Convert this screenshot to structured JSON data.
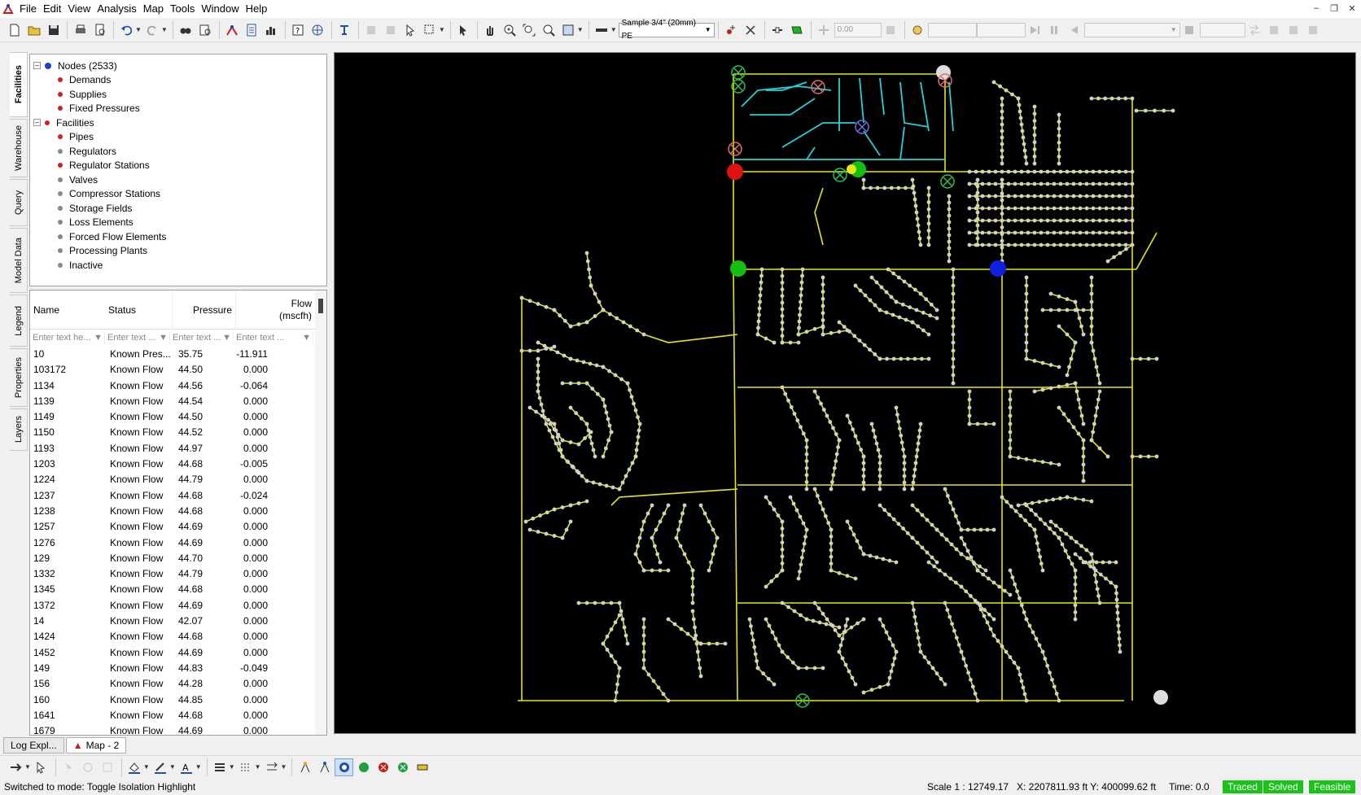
{
  "menubar": {
    "items": [
      "File",
      "Edit",
      "View",
      "Analysis",
      "Map",
      "Tools",
      "Window",
      "Help"
    ]
  },
  "toolbar": {
    "pipe_size_combo": "Sample 3/4\" (20mm) PE",
    "value_field": "0.00",
    "icons": [
      "new-icon",
      "open-icon",
      "save-icon",
      "print-icon",
      "print-preview-icon",
      "undo-icon",
      "redo-icon",
      "find-icon",
      "query-icon",
      "trace-icon",
      "report-icon",
      "chart-icon",
      "help-icon",
      "globe-icon",
      "layer-icon",
      "select-icon",
      "pan-icon",
      "zoom-in-icon",
      "zoom-extent-icon",
      "zoom-previous-icon",
      "zoom-window-icon",
      "pipe-tool-icon",
      "node-add-icon",
      "node-delete-icon",
      "regulator-icon",
      "supply-icon"
    ]
  },
  "sidetabs": [
    "Facilities",
    "Warehouse",
    "Query",
    "Model Data",
    "Legend",
    "Properties",
    "Layers"
  ],
  "tree": {
    "nodes_label": "Nodes (2533)",
    "node_children": [
      "Demands",
      "Supplies",
      "Fixed Pressures"
    ],
    "facilities_label": "Facilities",
    "facility_children": [
      "Pipes",
      "Regulators",
      "Regulator Stations",
      "Valves",
      "Compressor Stations",
      "Storage Fields",
      "Loss Elements",
      "Forced Flow Elements",
      "Processing Plants",
      "Inactive"
    ]
  },
  "grid": {
    "columns": [
      "Name",
      "Status",
      "Pressure",
      "Flow\n(mscfh)"
    ],
    "filter_placeholders": [
      "Enter text he...",
      "Enter text ...",
      "Enter text ...",
      "Enter text ..."
    ],
    "rows": [
      [
        "10",
        "Known Pres...",
        "35.75",
        "-11.911"
      ],
      [
        "103172",
        "Known Flow",
        "44.50",
        "0.000"
      ],
      [
        "1134",
        "Known Flow",
        "44.56",
        "-0.064"
      ],
      [
        "1139",
        "Known Flow",
        "44.54",
        "0.000"
      ],
      [
        "1149",
        "Known Flow",
        "44.50",
        "0.000"
      ],
      [
        "1150",
        "Known Flow",
        "44.52",
        "0.000"
      ],
      [
        "1193",
        "Known Flow",
        "44.97",
        "0.000"
      ],
      [
        "1203",
        "Known Flow",
        "44.68",
        "-0.005"
      ],
      [
        "1224",
        "Known Flow",
        "44.79",
        "0.000"
      ],
      [
        "1237",
        "Known Flow",
        "44.68",
        "-0.024"
      ],
      [
        "1238",
        "Known Flow",
        "44.68",
        "0.000"
      ],
      [
        "1257",
        "Known Flow",
        "44.69",
        "0.000"
      ],
      [
        "1276",
        "Known Flow",
        "44.69",
        "0.000"
      ],
      [
        "129",
        "Known Flow",
        "44.70",
        "0.000"
      ],
      [
        "1332",
        "Known Flow",
        "44.79",
        "0.000"
      ],
      [
        "1345",
        "Known Flow",
        "44.68",
        "0.000"
      ],
      [
        "1372",
        "Known Flow",
        "44.69",
        "0.000"
      ],
      [
        "14",
        "Known Flow",
        "42.07",
        "0.000"
      ],
      [
        "1424",
        "Known Flow",
        "44.68",
        "0.000"
      ],
      [
        "1452",
        "Known Flow",
        "44.69",
        "0.000"
      ],
      [
        "149",
        "Known Flow",
        "44.83",
        "-0.049"
      ],
      [
        "156",
        "Known Flow",
        "44.28",
        "0.000"
      ],
      [
        "160",
        "Known Flow",
        "44.85",
        "0.000"
      ],
      [
        "1641",
        "Known Flow",
        "44.68",
        "0.000"
      ],
      [
        "1679",
        "Known Flow",
        "44.69",
        "0.000"
      ]
    ]
  },
  "doc_tabs": [
    "Log Expl...",
    "Map - 2"
  ],
  "status": {
    "message": "Switched to mode: Toggle Isolation Highlight",
    "scale": "Scale  1 : 12749.17",
    "coords": "X: 2207811.93 ft Y: 400099.62 ft",
    "time": "Time: 0.0",
    "badges": [
      "Traced",
      "Solved",
      "Feasible"
    ]
  },
  "colors": {
    "map_background": "#000000",
    "pipe": "#e6e61a",
    "traced_pipe": "#26d0d6",
    "node": "#d0d0d0",
    "supply_green": "#12c012",
    "fixed_red": "#e01010",
    "demand_blue": "#1020e0",
    "status_green": "#1ac21a"
  }
}
